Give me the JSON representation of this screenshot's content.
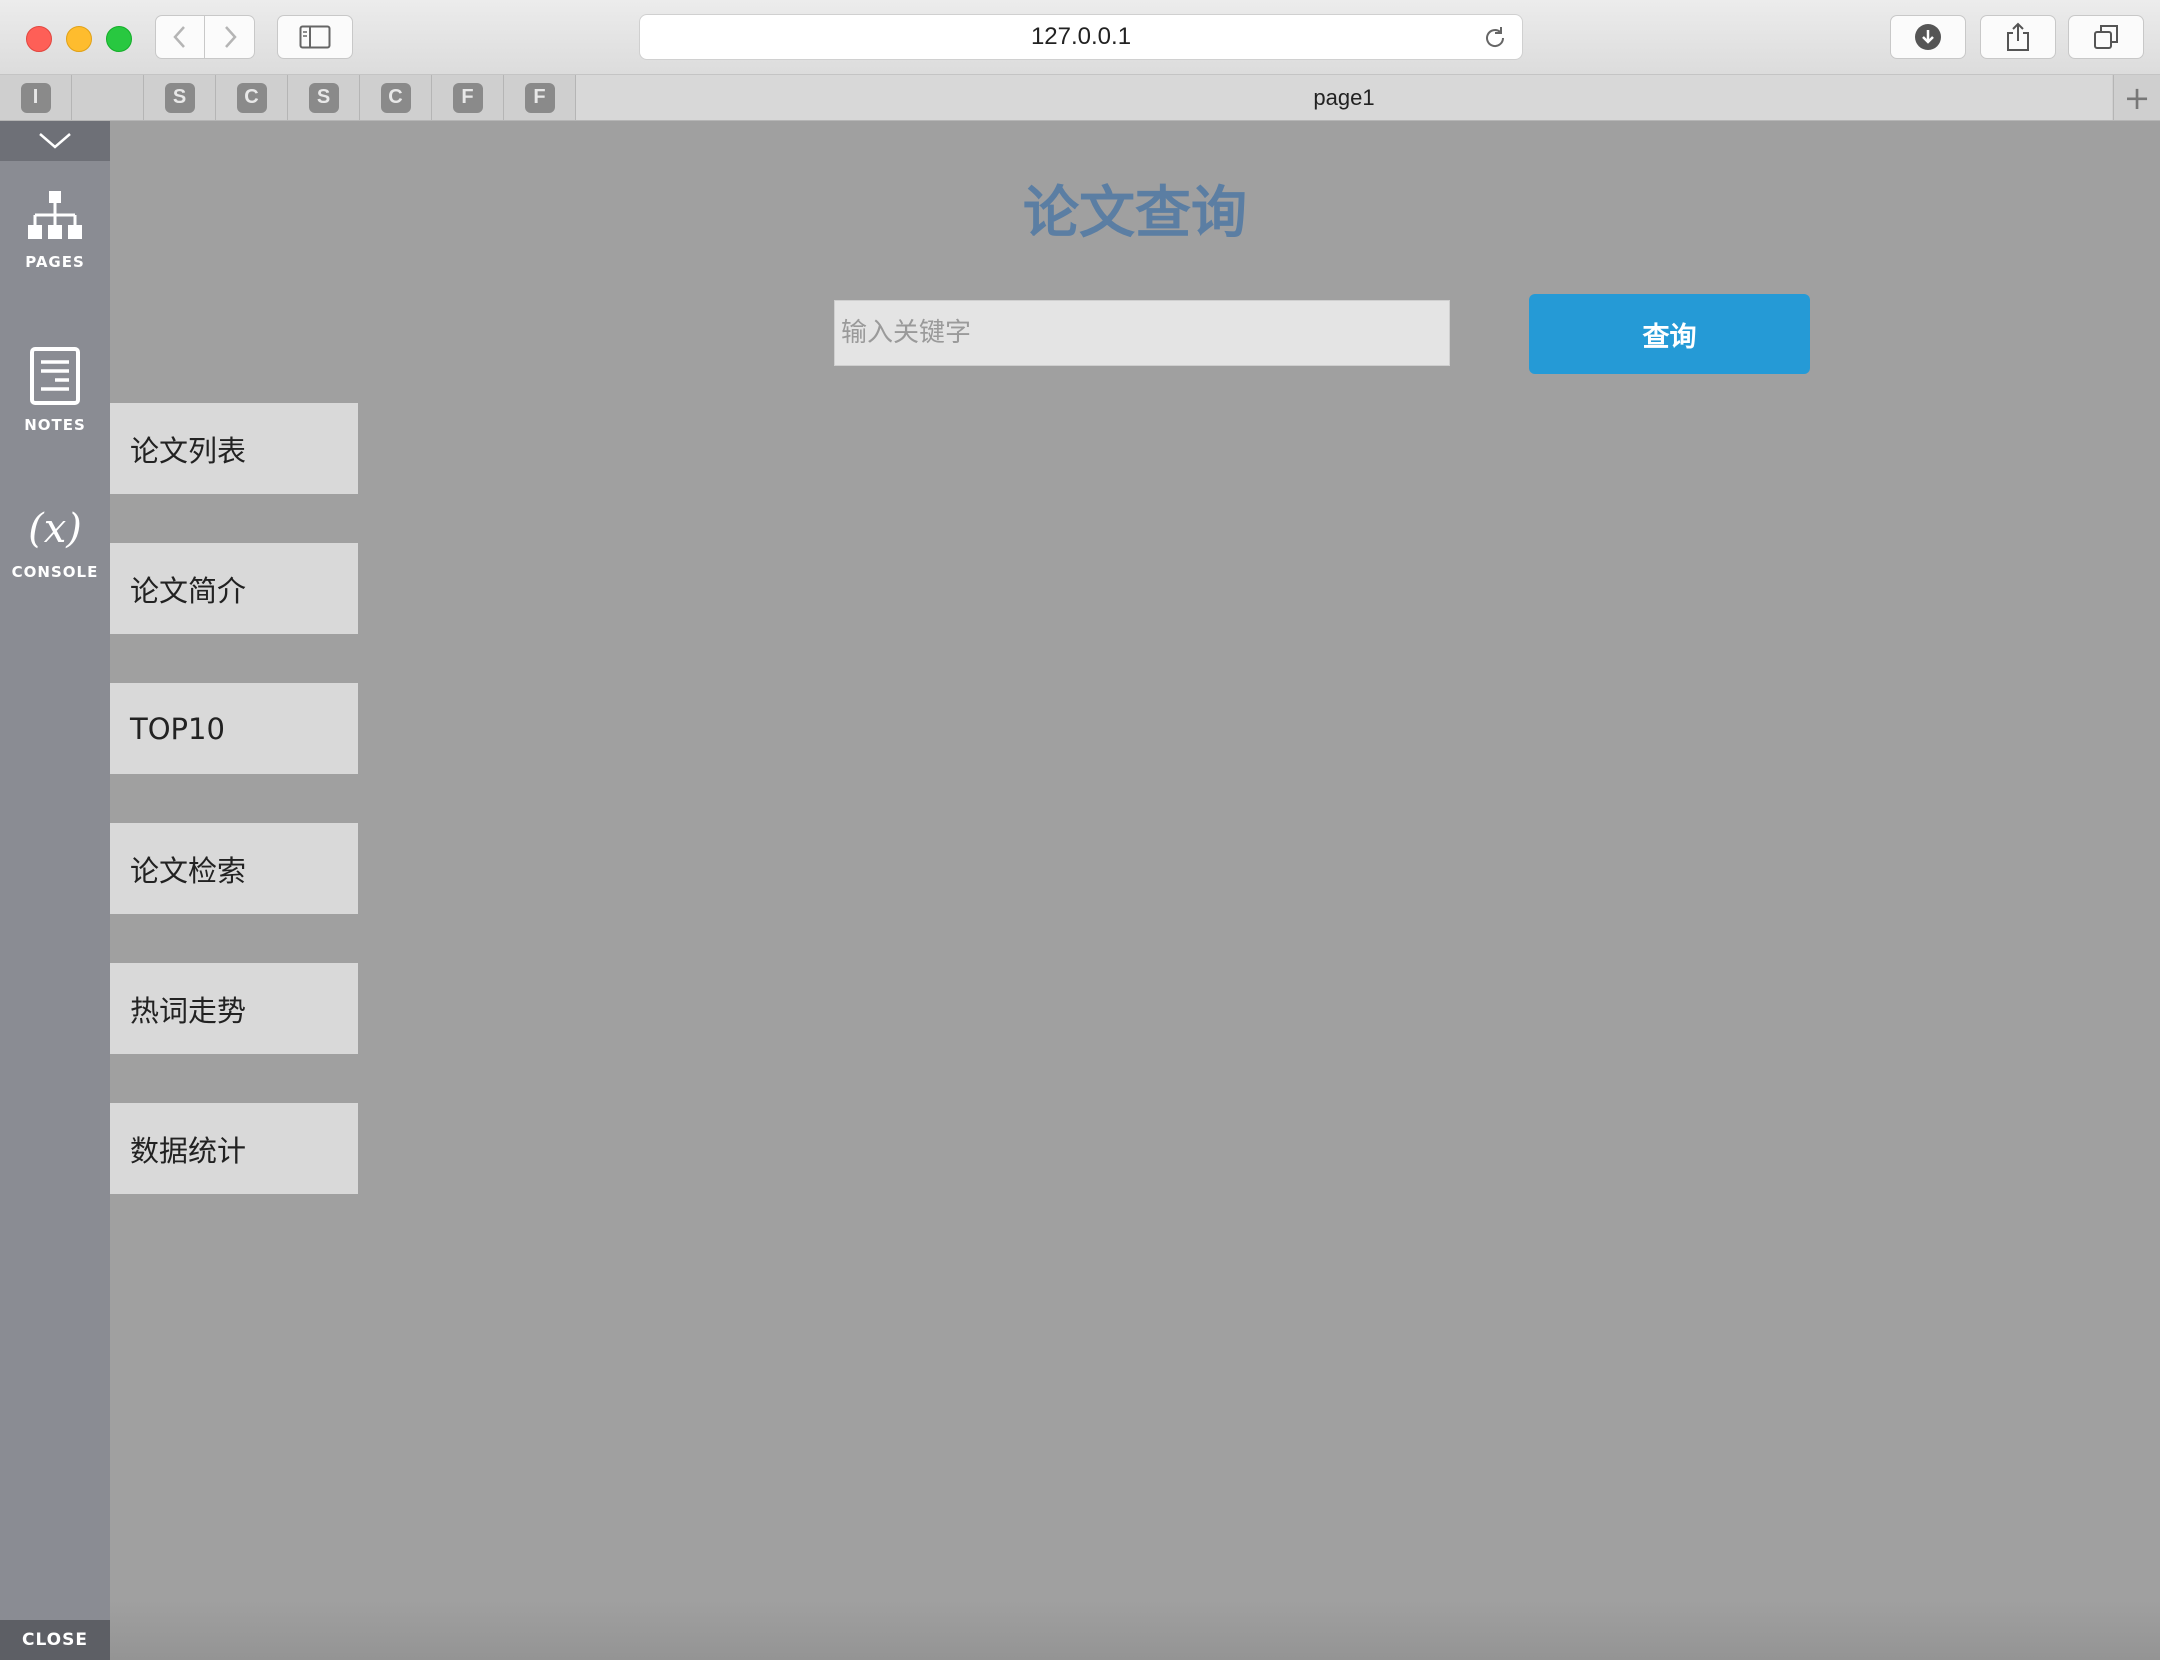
{
  "browser": {
    "url": "127.0.0.1",
    "tab_title": "page1",
    "pinned_tabs": [
      "I",
      "",
      "S",
      "C",
      "S",
      "C",
      "F",
      "F"
    ],
    "new_tab_symbol": "+"
  },
  "tool_panel": {
    "pages_label": "PAGES",
    "notes_label": "NOTES",
    "console_label": "CONSOLE",
    "console_symbol": "(x)",
    "close_label": "CLOSE"
  },
  "main": {
    "title": "论文查询",
    "search": {
      "placeholder": "输入关键字",
      "value": ""
    },
    "search_button": "查询"
  },
  "menu": {
    "items": [
      {
        "label": "论文列表"
      },
      {
        "label": "论文简介"
      },
      {
        "label": "TOP10"
      },
      {
        "label": "论文检索"
      },
      {
        "label": "热词走势"
      },
      {
        "label": "数据统计"
      }
    ]
  },
  "colors": {
    "accent": "#259ad6",
    "title": "#5b7ea3",
    "page_bg": "#a0a0a0",
    "panel_bg": "#8a8c93"
  }
}
